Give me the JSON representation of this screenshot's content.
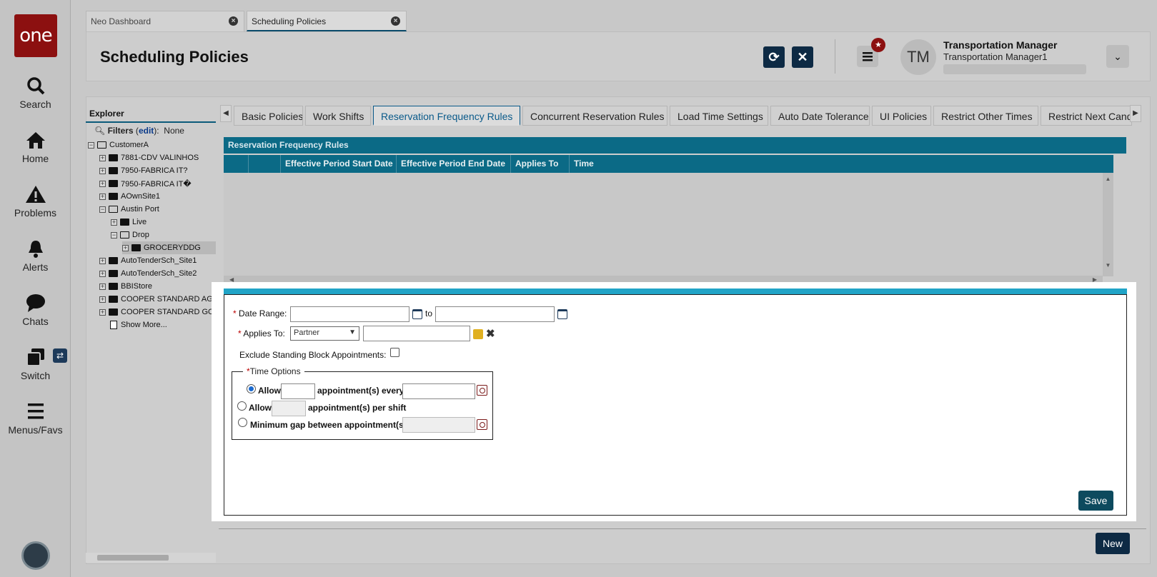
{
  "app": {
    "logo": "one"
  },
  "nav": {
    "search": "Search",
    "home": "Home",
    "problems": "Problems",
    "alerts": "Alerts",
    "chats": "Chats",
    "switch": "Switch",
    "menus": "Menus/Favs"
  },
  "tabs": [
    {
      "label": "Neo Dashboard"
    },
    {
      "label": "Scheduling Policies"
    }
  ],
  "header": {
    "title": "Scheduling Policies",
    "user_initials": "TM",
    "user_role": "Transportation Manager",
    "user_name": "Transportation Manager1"
  },
  "explorer": {
    "title": "Explorer",
    "filters_label": "Filters",
    "filters_edit": "edit",
    "filters_value": "None",
    "nodes": [
      "CustomerA",
      "7881-CDV VALINHOS",
      "7950-FABRICA IT?",
      "7950-FABRICA IT�",
      "AOwnSite1",
      "Austin Port",
      "Live",
      "Drop",
      "GROCERYDDG",
      "AutoTenderSch_Site1",
      "AutoTenderSch_Site2",
      "BBIStore",
      "COOPER STANDARD AGUA",
      "COOPER STANDARD GOLD",
      "Show More..."
    ]
  },
  "policy_tabs": [
    "Basic Policies",
    "Work Shifts",
    "Reservation Frequency Rules",
    "Concurrent Reservation Rules",
    "Load Time Settings",
    "Auto Date Tolerance",
    "UI Policies",
    "Restrict Other Times",
    "Restrict Next Candi"
  ],
  "grid": {
    "title": "Reservation Frequency Rules",
    "columns": [
      "Effective Period Start Date",
      "Effective Period End Date",
      "Applies To",
      "Time"
    ]
  },
  "form": {
    "date_range_label": "Date Range:",
    "to_label": "to",
    "applies_to_label": "Applies To:",
    "applies_to_value": "Partner",
    "exclude_label": "Exclude Standing Block Appointments:",
    "time_options_label": "Time Options",
    "allow_label": "Allow",
    "every_label": "appointment(s) every:",
    "per_shift_label": "appointment(s) per shift",
    "min_gap_label": "Minimum gap between appointment(s):",
    "required_mark": "*",
    "save": "Save"
  },
  "footer": {
    "new": "New"
  }
}
